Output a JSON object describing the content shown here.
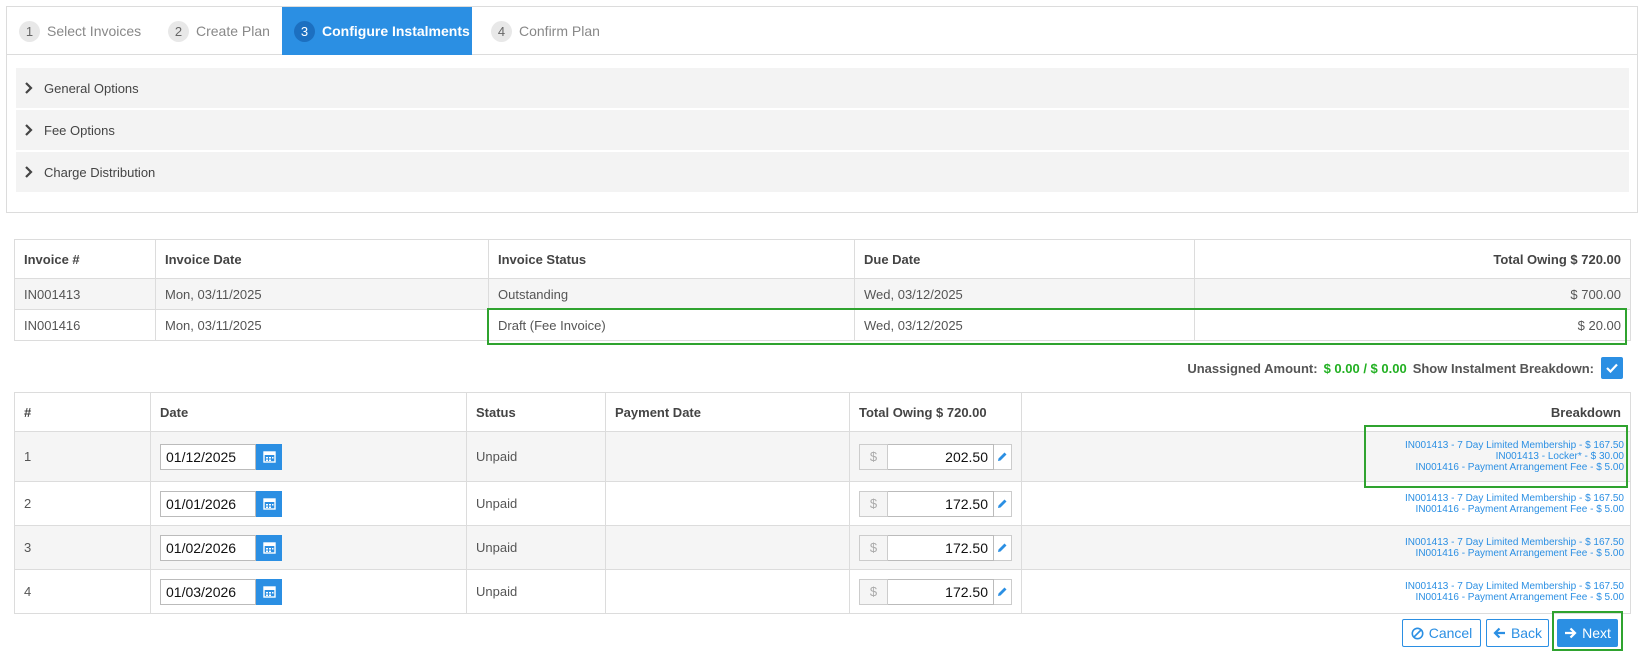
{
  "wizard": {
    "steps": [
      {
        "num": "1",
        "label": "Select Invoices"
      },
      {
        "num": "2",
        "label": "Create Plan"
      },
      {
        "num": "3",
        "label": "Configure Instalments"
      },
      {
        "num": "4",
        "label": "Confirm Plan"
      }
    ],
    "active_step": 3,
    "sections": [
      {
        "label": "General Options"
      },
      {
        "label": "Fee Options"
      },
      {
        "label": "Charge Distribution"
      }
    ]
  },
  "invoices": {
    "headers": [
      "Invoice #",
      "Invoice Date",
      "Invoice Status",
      "Due Date",
      "Total Owing $ 720.00"
    ],
    "rows": [
      {
        "number": "IN001413",
        "date": "Mon, 03/11/2025",
        "status": "Outstanding",
        "due": "Wed, 03/12/2025",
        "owing": "$ 700.00"
      },
      {
        "number": "IN001416",
        "date": "Mon, 03/11/2025",
        "status": "Draft (Fee Invoice)",
        "due": "Wed, 03/12/2025",
        "owing": "$ 20.00"
      }
    ]
  },
  "unassigned": {
    "label": "Unassigned Amount:",
    "value": "$ 0.00 / $ 0.00",
    "toggle_label": "Show Instalment Breakdown:",
    "toggle_checked": true
  },
  "instalments": {
    "headers": [
      "#",
      "Date",
      "Status",
      "Payment Date",
      "Total Owing $ 720.00",
      "Breakdown"
    ],
    "currency_symbol": "$",
    "rows": [
      {
        "num": "1",
        "date": "01/12/2025",
        "status": "Unpaid",
        "payment_date": "",
        "amount": "202.50",
        "breakdown": [
          "IN001413 - 7 Day Limited Membership - $ 167.50",
          "IN001413 - Locker* - $ 30.00",
          "IN001416 - Payment Arrangement Fee - $ 5.00"
        ]
      },
      {
        "num": "2",
        "date": "01/01/2026",
        "status": "Unpaid",
        "payment_date": "",
        "amount": "172.50",
        "breakdown": [
          "IN001413 - 7 Day Limited Membership - $ 167.50",
          "IN001416 - Payment Arrangement Fee - $ 5.00"
        ]
      },
      {
        "num": "3",
        "date": "01/02/2026",
        "status": "Unpaid",
        "payment_date": "",
        "amount": "172.50",
        "breakdown": [
          "IN001413 - 7 Day Limited Membership - $ 167.50",
          "IN001416 - Payment Arrangement Fee - $ 5.00"
        ]
      },
      {
        "num": "4",
        "date": "01/03/2026",
        "status": "Unpaid",
        "payment_date": "",
        "amount": "172.50",
        "breakdown": [
          "IN001413 - 7 Day Limited Membership - $ 167.50",
          "IN001416 - Payment Arrangement Fee - $ 5.00"
        ]
      }
    ]
  },
  "actions": {
    "cancel_label": "Cancel",
    "back_label": "Back",
    "next_label": "Next"
  },
  "colors": {
    "accent": "#2b8fe3",
    "highlight": "#2fa32f",
    "value_green": "#22b022"
  }
}
